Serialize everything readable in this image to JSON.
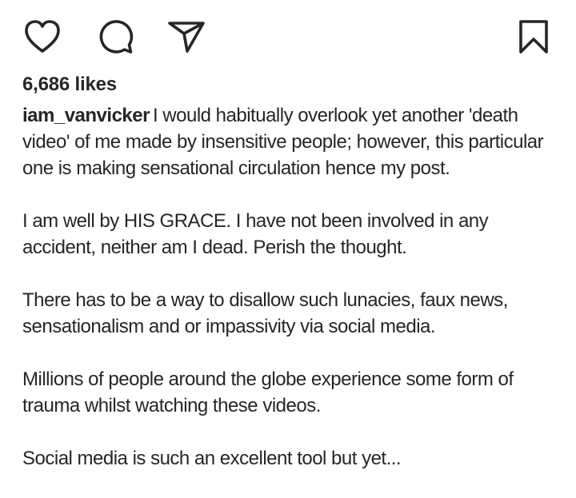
{
  "actions": {
    "like_icon": "heart-icon",
    "comment_icon": "comment-bubble-icon",
    "share_icon": "paper-plane-icon",
    "save_icon": "bookmark-icon"
  },
  "post": {
    "likes": "6,686 likes",
    "username": "iam_vanvicker",
    "caption_first": "I would habitually overlook yet another 'death video' of me made by insensitive people; however, this particular one is making sensational circulation hence my post.",
    "paragraphs": [
      "I am well by HIS GRACE. I have not been involved in any accident, neither am I dead. Perish the thought.",
      "There has to be a way to disallow such lunacies, faux news, sensationalism and or impassivity via social media.",
      "Millions of people around the globe experience some form of trauma whilst watching these videos.",
      "Social media is such an excellent tool but yet..."
    ]
  }
}
